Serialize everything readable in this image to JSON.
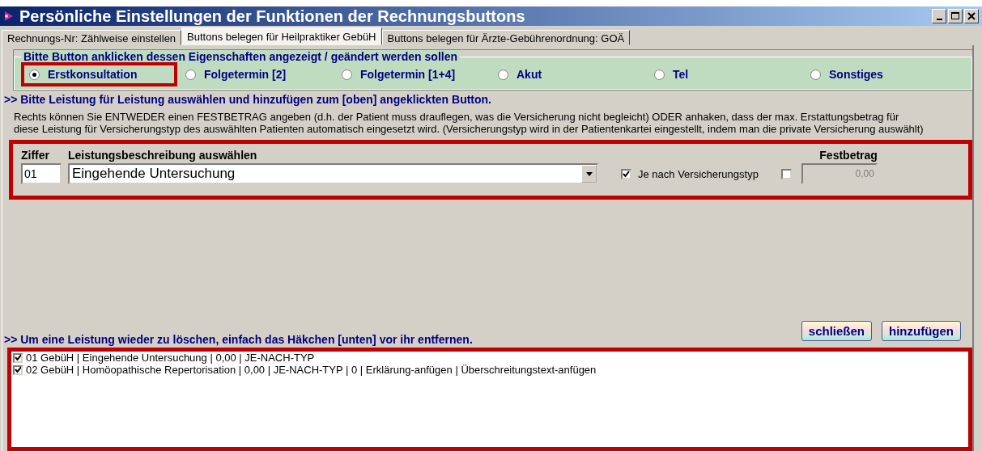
{
  "window": {
    "title": "Persönliche Einstellungen der Funktionen der Rechnungsbuttons"
  },
  "tabs": [
    {
      "label": "Rechnungs-Nr: Zählweise einstellen",
      "selected": false
    },
    {
      "label": "Buttons belegen für Heilpraktiker GebüH",
      "selected": true
    },
    {
      "label": "Buttons belegen für Ärzte-Gebührenordnung: GOÄ",
      "selected": false
    }
  ],
  "button_choice": {
    "legend": "Bitte Button anklicken dessen Eigenschaften angezeigt / geändert werden sollen",
    "options": [
      {
        "label": "Erstkonsultation",
        "selected": true,
        "highlighted": true
      },
      {
        "label": "Folgetermin [2]",
        "selected": false,
        "highlighted": false
      },
      {
        "label": "Folgetermin [1+4]",
        "selected": false,
        "highlighted": false
      },
      {
        "label": "Akut",
        "selected": false,
        "highlighted": false
      },
      {
        "label": "Tel",
        "selected": false,
        "highlighted": false
      },
      {
        "label": "Sonstiges",
        "selected": false,
        "highlighted": false
      }
    ]
  },
  "section_heading": ">> Bitte Leistung für Leistung auswählen und hinzufügen zum [oben] angeklickten Button.",
  "description": "Rechts können Sie ENTWEDER einen FESTBETRAG angeben (d.h. der Patient muss drauflegen, was die Versicherung nicht begleicht) ODER anhaken, dass der max. Erstattungsbetrag für diese Leistung für Versicherungstyp des auswählten Patienten automatisch eingesetzt wird. (Versicherungstyp wird in der Patientenkartei eingestellt, indem man die private Versicherung auswählt)",
  "entry": {
    "highlighted": true,
    "ziffer_label": "Ziffer",
    "ziffer_value": "01",
    "description_label": "Leistungsbeschreibung auswählen",
    "description_value": "Eingehende Untersuchung",
    "by_insurance": {
      "label": "Je nach Versicherungstyp",
      "checked": true
    },
    "fixed_amount": {
      "label": "Festbetrag",
      "checked": false,
      "value": "0,00",
      "disabled": true
    }
  },
  "delete_hint": ">> Um eine Leistung wieder zu löschen, einfach das Häkchen [unten] vor ihr entfernen.",
  "buttons": [
    "schließen",
    "hinzufügen"
  ],
  "services": {
    "highlighted": true,
    "items": [
      {
        "text": "01 GebüH | Eingehende Untersuchung | 0,00 | JE-NACH-TYP",
        "checked": true
      },
      {
        "text": "02 GebüH | Homöopathische Repertorisation | 0,00 | JE-NACH-TYP | 0 | Erklärung-anfügen | Überschreitungstext-anfügen",
        "checked": true
      }
    ]
  }
}
